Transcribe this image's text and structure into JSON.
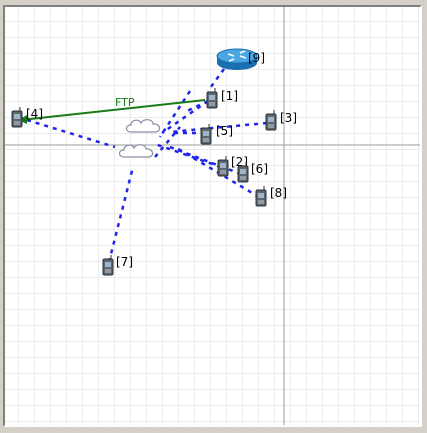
{
  "window": {
    "background": "#ffffff",
    "grid_color": "#d8d8d8",
    "axis_color": "#9a9a9a"
  },
  "link_colors": {
    "wireless": "#1f25e8",
    "ftp": "#1a7a1a"
  },
  "nodes": {
    "n1": "[1]",
    "n2": "[2]",
    "n3": "[3]",
    "n4": "[4]",
    "n5": "[5]",
    "n6": "[6]",
    "n7": "[7]",
    "n8": "[8]",
    "n9": "[9]"
  },
  "flow": {
    "label": "FTP",
    "from": "[1]",
    "to": "[4]"
  },
  "icons": {
    "router": "router-icon",
    "phone": "mobile-phone-icon",
    "cloud": "cloud-icon"
  }
}
